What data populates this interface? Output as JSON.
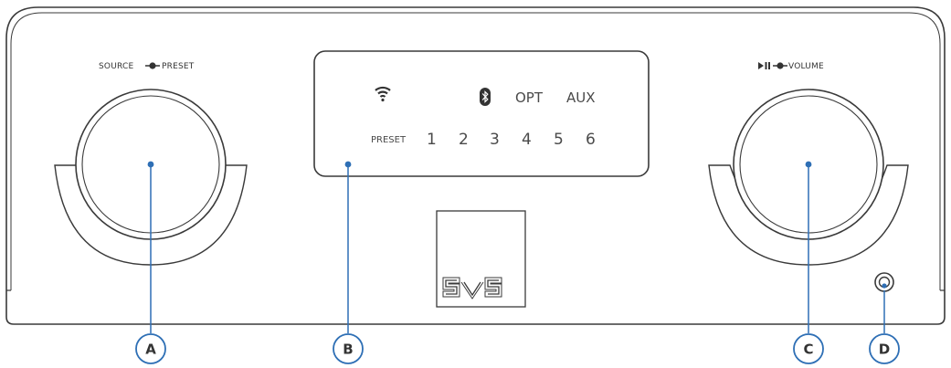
{
  "colors": {
    "outline": "#3a3a3a",
    "accent": "#2e6fb5",
    "panel": "#ffffff"
  },
  "labels": {
    "left_knob": "SOURCE ",
    "left_knob_b": " PRESET",
    "right_knob_b": " VOLUME",
    "display": {
      "opt": "OPT",
      "aux": "AUX",
      "preset": "PRESET",
      "numbers": [
        "1",
        "2",
        "3",
        "4",
        "5",
        "6"
      ]
    },
    "logo_text": "SVS"
  },
  "icons": {
    "left_knob_icon": "knob-turn-icon",
    "right_knob_icon": "play-pause-icon",
    "display_icons": [
      "wifi-icon",
      "bluetooth-icon"
    ],
    "jack": "headphone-jack-icon"
  },
  "callouts": [
    {
      "id": "a",
      "letter": "A"
    },
    {
      "id": "b",
      "letter": "B"
    },
    {
      "id": "c",
      "letter": "C"
    },
    {
      "id": "d",
      "letter": "D"
    }
  ]
}
